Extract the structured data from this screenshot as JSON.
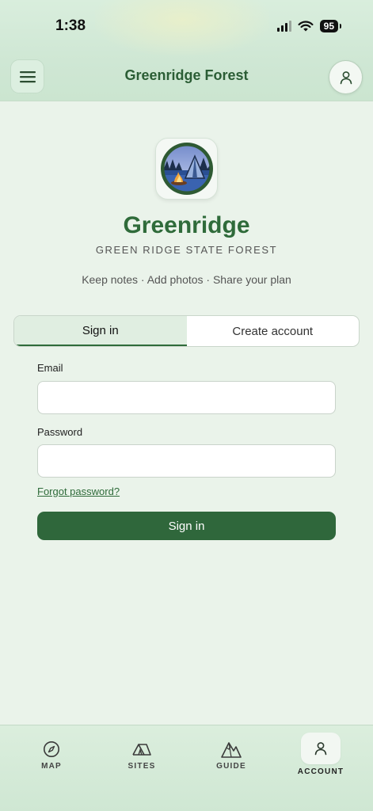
{
  "status_bar": {
    "time": "1:38",
    "battery": "95"
  },
  "header": {
    "title": "Greenridge Forest"
  },
  "hero": {
    "brand": "Greenridge",
    "subtitle": "GREEN RIDGE STATE FOREST",
    "tagline": "Keep notes · Add photos · Share your plan"
  },
  "tabs": [
    {
      "label": "Sign in",
      "active": true
    },
    {
      "label": "Create account",
      "active": false
    }
  ],
  "form": {
    "email_label": "Email",
    "email_value": "",
    "password_label": "Password",
    "password_value": "",
    "forgot_label": "Forgot password?",
    "submit_label": "Sign in"
  },
  "bottom_nav": [
    {
      "label": "MAP",
      "icon": "compass-icon",
      "active": false
    },
    {
      "label": "SITES",
      "icon": "tent-icon",
      "active": false
    },
    {
      "label": "GUIDE",
      "icon": "mountain-icon",
      "active": false
    },
    {
      "label": "ACCOUNT",
      "icon": "user-icon",
      "active": true
    }
  ],
  "colors": {
    "brand": "#2f6b3a",
    "primary_button": "#2f673b",
    "background": "#eaf3ea"
  }
}
